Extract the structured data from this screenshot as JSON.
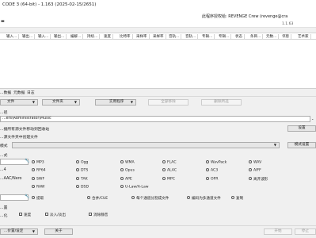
{
  "window": {
    "title": "CODE 3 (64-bit) - 1.163 (2025-02-15/2651)",
    "license": "此程序授权给: REVENGE Crew (revenge@cra",
    "version": "1.1.63",
    "menu_button": "▬"
  },
  "columns": [
    "输入...",
    "输出...",
    "输入...",
    "输出...",
    "编解...",
    "持续...",
    "速度",
    "比特率",
    "采样率",
    "采样率",
    "音轨...",
    "音轨...",
    "专辑...",
    "专辑...",
    "状态",
    "条目...",
    "元数...",
    "邻葱",
    "艺术家"
  ],
  "tabs": [
    "...数据",
    "元数据",
    "日志"
  ],
  "row1": {
    "file_dd": "文件",
    "folder_dd": "文件夹",
    "apps_dd": "实用程序",
    "remove_all": "全部移除",
    "remove_selected": "删除所选"
  },
  "output": {
    "path_label": "...径",
    "path_value": "...ers\\Administrator\\Music",
    "move_source_label": "...播所有源文件移动到回收站",
    "settings_btn": "设置",
    "create_folder_label": "...源文件夹中创建文件",
    "mode_label": "模式",
    "mode_settings_btn": "模式设置"
  },
  "format": {
    "section_label": "...式",
    "options": [
      [
        "MP3",
        "Ogg",
        "WMA",
        "FLAC",
        "WavPack",
        "WAV"
      ],
      [
        "RF64",
        "DTS",
        "Opus",
        "ALAC",
        "AC3",
        "AIFF"
      ],
      [
        "SWF",
        "TAK",
        "APE",
        "MPC",
        "OFR",
        "离开波形"
      ],
      [
        "RAW",
        "DSD",
        "U-Law/A-Law",
        "",
        "",
        ""
      ]
    ],
    "row_prefixes": [
      "",
      "...4",
      "...AAC/Nero",
      ""
    ]
  },
  "extract": {
    "options": [
      "提取",
      "合并/CUE",
      "每个通道分割成文件",
      "编码为多通道文件",
      "复制"
    ]
  },
  "misc": {
    "section_label": "...置",
    "prefix": "...化",
    "checks": [
      "速度",
      "淡入/淡出",
      "消除静音"
    ]
  },
  "bottom": {
    "preset_dd": "...价置/设定",
    "about_btn": "关于",
    "start_btn": "开始",
    "stop_btn": "停止"
  }
}
